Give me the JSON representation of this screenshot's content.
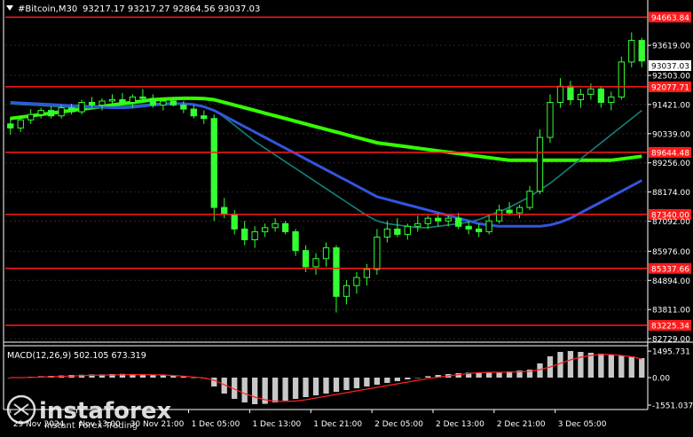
{
  "header": {
    "symbol_timeframe": "#Bitcoin,M30",
    "ohlc": "93217.17 93217.27 92864.56 93037.03",
    "current_price": "93037.03"
  },
  "indicator": {
    "label": "MACD(12,26,9) 502.105 673.319",
    "axis_labels": [
      "1495.731",
      "0.00",
      "-1551.037"
    ]
  },
  "watermark": {
    "brand": "instaforex",
    "tagline": "Instant Forex Trading"
  },
  "colors": {
    "background": "#000000",
    "candles": "#33ff33",
    "levels": "#ff1a1a",
    "ma_green": "#33ff00",
    "ma_blue": "#3355dd",
    "ma_teal": "#14807e",
    "macd_hist": "#c8c8c8",
    "macd_signal": "#ff2020",
    "text": "#ffffff"
  },
  "chart_data": {
    "type": "candlestick",
    "price_axis_ticks": [
      93619.0,
      92503.0,
      91421.0,
      90339.0,
      89256.0,
      88174.0,
      87092.0,
      85976.0,
      84894.0,
      83811.0,
      82729.0
    ],
    "price_axis_labels": [
      "93619.00",
      "92503.00",
      "91421.00",
      "90339.00",
      "89256.00",
      "88174.00",
      "87092.00",
      "85976.00",
      "84894.00",
      "83811.00",
      "82729.00"
    ],
    "ylim": [
      82600,
      95300
    ],
    "levels": [
      {
        "value": 94663.84,
        "label": "94663.84"
      },
      {
        "value": 92077.71,
        "label": "92077.71"
      },
      {
        "value": 89644.48,
        "label": "89644.48"
      },
      {
        "value": 87340.0,
        "label": "87340.00"
      },
      {
        "value": 85337.66,
        "label": "85337.66"
      },
      {
        "value": 83225.34,
        "label": "83225.34"
      }
    ],
    "time_axis_labels": [
      "29 Nov 2024",
      "Nov 13:00",
      "30 Nov 21:00",
      "1 Dec 05:00",
      "1 Dec 13:00",
      "1 Dec 21:00",
      "2 Dec 05:00",
      "2 Dec 13:00",
      "2 Dec 21:00",
      "3 Dec 05:00"
    ],
    "time_axis_x": [
      0,
      6.5,
      11.5,
      17.5,
      23.5,
      29.5,
      35.5,
      41.5,
      47.5,
      53.5
    ],
    "xlim": [
      -0.5,
      62.5
    ],
    "ohlc": [
      [
        90700,
        90950,
        90300,
        90550
      ],
      [
        90550,
        91000,
        90400,
        90850
      ],
      [
        90850,
        91250,
        90700,
        91050
      ],
      [
        91050,
        91300,
        90900,
        91200
      ],
      [
        91200,
        91350,
        90900,
        91000
      ],
      [
        91000,
        91400,
        90900,
        91300
      ],
      [
        91300,
        91450,
        91050,
        91150
      ],
      [
        91150,
        91600,
        91050,
        91500
      ],
      [
        91500,
        91700,
        91300,
        91400
      ],
      [
        91400,
        91650,
        91200,
        91550
      ],
      [
        91550,
        91800,
        91400,
        91600
      ],
      [
        91600,
        91850,
        91400,
        91500
      ],
      [
        91500,
        91800,
        91300,
        91700
      ],
      [
        91700,
        92000,
        91500,
        91650
      ],
      [
        91650,
        91800,
        91300,
        91400
      ],
      [
        91400,
        91600,
        91200,
        91550
      ],
      [
        91550,
        91700,
        91350,
        91400
      ],
      [
        91400,
        91550,
        91100,
        91250
      ],
      [
        91250,
        91400,
        90900,
        91000
      ],
      [
        91000,
        91200,
        90700,
        90900
      ],
      [
        90900,
        91050,
        87100,
        87600
      ],
      [
        87600,
        87950,
        87200,
        87350
      ],
      [
        87350,
        87500,
        86600,
        86800
      ],
      [
        86800,
        87100,
        86200,
        86400
      ],
      [
        86400,
        86900,
        86100,
        86700
      ],
      [
        86700,
        87000,
        86500,
        86850
      ],
      [
        86850,
        87200,
        86700,
        87000
      ],
      [
        87000,
        87100,
        86600,
        86700
      ],
      [
        86700,
        86800,
        85800,
        86000
      ],
      [
        86000,
        86200,
        85200,
        85400
      ],
      [
        85400,
        85900,
        85100,
        85700
      ],
      [
        85700,
        86300,
        85400,
        86100
      ],
      [
        86100,
        86200,
        83700,
        84300
      ],
      [
        84300,
        84900,
        84000,
        84700
      ],
      [
        84700,
        85200,
        84400,
        85000
      ],
      [
        85000,
        85500,
        84700,
        85300
      ],
      [
        85300,
        86800,
        85100,
        86500
      ],
      [
        86500,
        87100,
        86300,
        86800
      ],
      [
        86800,
        87200,
        86500,
        86600
      ],
      [
        86600,
        87000,
        86400,
        86900
      ],
      [
        86900,
        87300,
        86700,
        87000
      ],
      [
        87000,
        87300,
        86800,
        87200
      ],
      [
        87200,
        87400,
        86900,
        87100
      ],
      [
        87100,
        87300,
        86900,
        87200
      ],
      [
        87200,
        87400,
        86800,
        86900
      ],
      [
        86900,
        87100,
        86600,
        86800
      ],
      [
        86800,
        87000,
        86500,
        86700
      ],
      [
        86700,
        87300,
        86600,
        87100
      ],
      [
        87100,
        87700,
        87000,
        87500
      ],
      [
        87500,
        87800,
        87300,
        87400
      ],
      [
        87400,
        87700,
        87200,
        87600
      ],
      [
        87600,
        88400,
        87500,
        88200
      ],
      [
        88200,
        90500,
        88100,
        90200
      ],
      [
        90200,
        91800,
        90000,
        91500
      ],
      [
        91500,
        92400,
        91300,
        92100
      ],
      [
        92100,
        92300,
        91400,
        91600
      ],
      [
        91600,
        92000,
        91300,
        91800
      ],
      [
        91800,
        92200,
        91600,
        92000
      ],
      [
        92000,
        92100,
        91300,
        91500
      ],
      [
        91500,
        91900,
        91200,
        91700
      ],
      [
        91700,
        93200,
        91600,
        93000
      ],
      [
        93000,
        94100,
        92800,
        93800
      ],
      [
        93800,
        93900,
        92800,
        93037
      ]
    ],
    "series": [
      {
        "values": [
          90900,
          90950,
          91000,
          91050,
          91100,
          91150,
          91200,
          91250,
          91300,
          91350,
          91400,
          91450,
          91500,
          91550,
          91600,
          91620,
          91640,
          91650,
          91650,
          91640,
          91600,
          91500,
          91400,
          91300,
          91200,
          91100,
          91000,
          90900,
          90800,
          90700,
          90600,
          90500,
          90400,
          90300,
          90200,
          90100,
          90000,
          89950,
          89900,
          89850,
          89800,
          89750,
          89700,
          89650,
          89600,
          89550,
          89500,
          89450,
          89400,
          89350,
          89350,
          89350,
          89350,
          89350,
          89350,
          89350,
          89350,
          89350,
          89350,
          89350,
          89400,
          89450,
          89500
        ]
      },
      {
        "values": [
          91450,
          91420,
          91400,
          91380,
          91360,
          91340,
          91320,
          91300,
          91300,
          91310,
          91330,
          91350,
          91380,
          91410,
          91440,
          91470,
          91480,
          91470,
          91430,
          91350,
          91200,
          90950,
          90650,
          90350,
          90050,
          89800,
          89550,
          89300,
          89050,
          88800,
          88550,
          88300,
          88050,
          87800,
          87550,
          87300,
          87100,
          87000,
          86950,
          86900,
          86850,
          86850,
          86900,
          86950,
          87000,
          87050,
          87150,
          87300,
          87450,
          87600,
          87800,
          88000,
          88250,
          88500,
          88800,
          89100,
          89400,
          89700,
          90000,
          90300,
          90600,
          90900,
          91200
        ]
      },
      {
        "values": [
          91500,
          91480,
          91460,
          91440,
          91420,
          91400,
          91380,
          91360,
          91340,
          91320,
          91300,
          91300,
          91320,
          91360,
          91400,
          91430,
          91450,
          91450,
          91420,
          91340,
          91200,
          91000,
          90800,
          90600,
          90400,
          90200,
          90000,
          89800,
          89600,
          89400,
          89200,
          89000,
          88800,
          88600,
          88400,
          88200,
          88000,
          87900,
          87800,
          87700,
          87600,
          87500,
          87400,
          87300,
          87200,
          87100,
          87000,
          86950,
          86900,
          86900,
          86900,
          86900,
          86900,
          86950,
          87050,
          87200,
          87400,
          87600,
          87800,
          88000,
          88200,
          88400,
          88600
        ]
      }
    ],
    "macd": {
      "histogram": [
        0,
        0,
        50,
        80,
        100,
        120,
        150,
        160,
        180,
        180,
        200,
        210,
        200,
        190,
        170,
        140,
        100,
        50,
        0,
        -50,
        -500,
        -900,
        -1200,
        -1400,
        -1500,
        -1480,
        -1400,
        -1300,
        -1200,
        -1100,
        -1000,
        -900,
        -800,
        -700,
        -600,
        -500,
        -400,
        -300,
        -200,
        -100,
        0,
        80,
        150,
        200,
        250,
        280,
        300,
        300,
        300,
        350,
        400,
        450,
        800,
        1200,
        1450,
        1500,
        1450,
        1400,
        1350,
        1300,
        1250,
        1200,
        1100
      ],
      "signal": [
        0,
        0,
        10,
        30,
        50,
        70,
        90,
        110,
        130,
        140,
        150,
        160,
        170,
        170,
        160,
        150,
        120,
        80,
        30,
        -20,
        -150,
        -400,
        -650,
        -900,
        -1100,
        -1250,
        -1330,
        -1350,
        -1320,
        -1250,
        -1150,
        -1050,
        -950,
        -850,
        -750,
        -650,
        -550,
        -450,
        -350,
        -250,
        -150,
        -60,
        20,
        100,
        170,
        230,
        280,
        300,
        300,
        310,
        330,
        360,
        450,
        600,
        800,
        1000,
        1150,
        1250,
        1300,
        1300,
        1250,
        1180,
        1050
      ],
      "ylim": [
        -1750,
        1750
      ]
    }
  }
}
